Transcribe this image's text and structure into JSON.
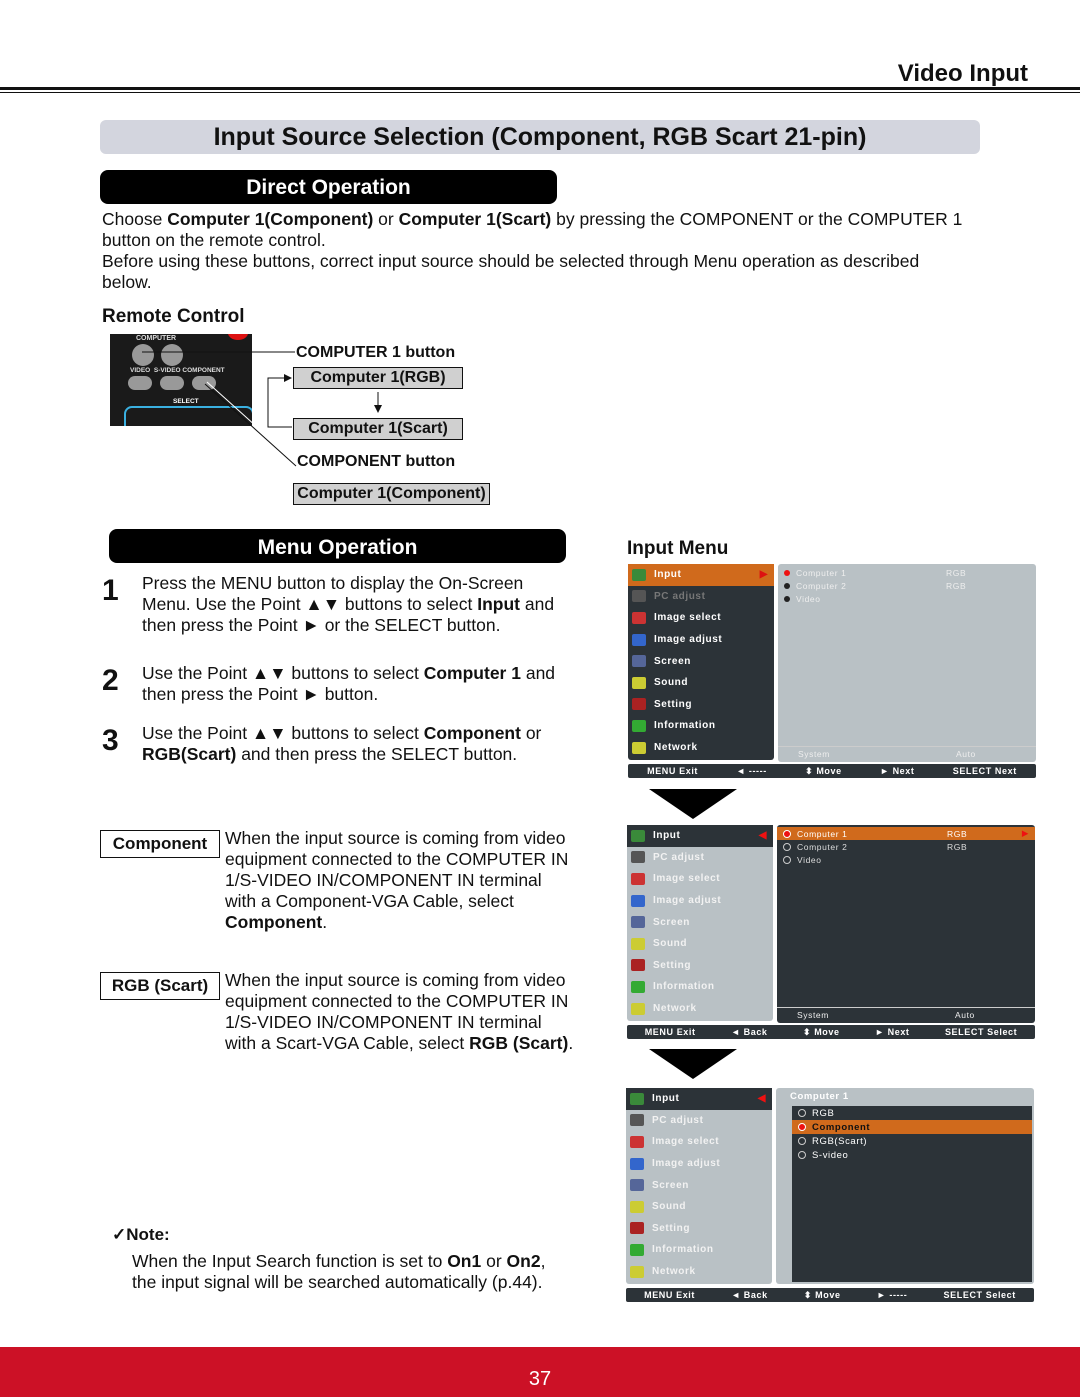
{
  "header": {
    "section": "Video Input"
  },
  "banner": "Input Source Selection (Component, RGB Scart 21-pin)",
  "direct": {
    "title": "Direct Operation",
    "p1": [
      {
        "t": "Choose "
      },
      {
        "t": "Computer 1(Component)",
        "b": 1
      },
      {
        "t": " or "
      },
      {
        "t": "Computer 1(Scart)",
        "b": 1
      },
      {
        "t": " by pressing the COMPONENT or the COMPUTER 1 button on the remote control."
      }
    ],
    "p2": "Before using these buttons, correct input source should be selected through Menu operation as described below."
  },
  "remote": {
    "title": "Remote Control",
    "labels": {
      "computer": "COMPUTER",
      "video": "VIDEO",
      "svideo": "S-VIDEO",
      "component": "COMPONENT",
      "select": "SELECT"
    },
    "computer1_button": "COMPUTER 1 button",
    "rgb": "Computer 1(RGB)",
    "scart": "Computer 1(Scart)",
    "component_button": "COMPONENT button",
    "component": "Computer 1(Component)"
  },
  "menuop": {
    "title": "Menu Operation",
    "steps": [
      {
        "n": "1",
        "parts": [
          {
            "t": "Press the MENU button to display the On-Screen Menu. Use the Point ▲▼ buttons to select "
          },
          {
            "t": "Input",
            "b": 1
          },
          {
            "t": " and then press the Point ► or the SELECT button."
          }
        ]
      },
      {
        "n": "2",
        "parts": [
          {
            "t": "Use the Point ▲▼ buttons to select "
          },
          {
            "t": "Computer 1",
            "b": 1
          },
          {
            "t": " and then press the Point ► button."
          }
        ]
      },
      {
        "n": "3",
        "parts": [
          {
            "t": "Use the Point ▲▼ buttons to select "
          },
          {
            "t": "Component",
            "b": 1
          },
          {
            "t": " or "
          },
          {
            "t": "RGB(Scart)",
            "b": 1
          },
          {
            "t": " and then press the SELECT button."
          }
        ]
      }
    ]
  },
  "options": [
    {
      "tag": "Component",
      "parts": [
        {
          "t": "When the input source is coming from video equipment connected to the COMPUTER IN 1/S-VIDEO IN/COMPONENT IN terminal with a Component-VGA Cable, select "
        },
        {
          "t": "Component",
          "b": 1
        },
        {
          "t": "."
        }
      ]
    },
    {
      "tag": "RGB (Scart)",
      "parts": [
        {
          "t": "When the input source is coming from video equipment connected to the COMPUTER IN 1/S-VIDEO IN/COMPONENT IN terminal with a Scart-VGA Cable, select "
        },
        {
          "t": "RGB (Scart)",
          "b": 1
        },
        {
          "t": "."
        }
      ]
    }
  ],
  "note": {
    "title": "✓Note:",
    "parts": [
      {
        "t": "When the Input Search function is set to "
      },
      {
        "t": "On1",
        "b": 1
      },
      {
        "t": " or "
      },
      {
        "t": "On2",
        "b": 1
      },
      {
        "t": ", the input signal will be searched automatically (p.44)."
      }
    ]
  },
  "input_menu": {
    "title": "Input Menu",
    "items": [
      "Input",
      "PC adjust",
      "Image select",
      "Image adjust",
      "Screen",
      "Sound",
      "Setting",
      "Information",
      "Network"
    ],
    "icon_colors": [
      "#3a8a3a",
      "#555",
      "#c33",
      "#36c",
      "#569",
      "#cc3",
      "#a22",
      "#3a3",
      "#cc3"
    ],
    "menus": [
      {
        "sources": [
          [
            "Computer 1",
            "RGB"
          ],
          [
            "Computer 2",
            "RGB"
          ],
          [
            "Video",
            ""
          ]
        ],
        "system": [
          "System",
          "Auto"
        ],
        "bottom": [
          "MENU Exit",
          "◄ -----",
          "⬍ Move",
          "► Next",
          "SELECT Next"
        ]
      },
      {
        "sources": [
          [
            "Computer 1",
            "RGB"
          ],
          [
            "Computer 2",
            "RGB"
          ],
          [
            "Video",
            ""
          ]
        ],
        "system": [
          "System",
          "Auto"
        ],
        "bottom": [
          "MENU Exit",
          "◄ Back",
          "⬍ Move",
          "► Next",
          "SELECT Select"
        ]
      },
      {
        "header": "Computer 1",
        "sub": [
          "RGB",
          "Component",
          "RGB(Scart)",
          "S-video"
        ],
        "bottom": [
          "MENU Exit",
          "◄ Back",
          "⬍ Move",
          "► -----",
          "SELECT Select"
        ]
      }
    ]
  },
  "colors": {
    "orange": "#d06a1c",
    "dark": "#2c3338",
    "light": "#b9c1c5",
    "footer": "#cc1126"
  },
  "page_number": "37"
}
